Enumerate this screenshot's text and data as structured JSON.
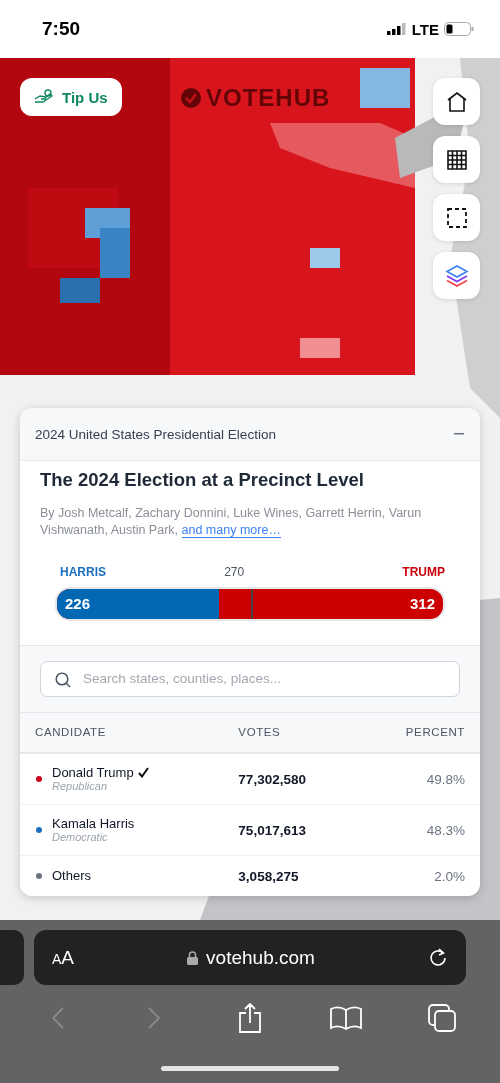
{
  "status_bar": {
    "time": "7:50",
    "network": "LTE"
  },
  "map": {
    "kind": "picture",
    "logo": "VOTEHUB",
    "tip_button": "Tip Us"
  },
  "map_tools": [
    {
      "kind": "home"
    },
    {
      "kind": "grid"
    },
    {
      "kind": "select"
    },
    {
      "kind": "layers"
    }
  ],
  "panel": {
    "header": "2024 United States Presidential Election",
    "title": "The 2024 Election at a Precinct Level",
    "byline": "By Josh Metcalf, Zachary Donnini, Luke Wines, Garrett Herrin, Varun Vishwanath, Austin Park,",
    "byline_link": "and many more…",
    "electoral": {
      "left_label": "HARRIS",
      "threshold": "270",
      "right_label": "TRUMP",
      "left_value": "226",
      "right_value": "312",
      "level": 0.42
    },
    "search": {
      "placeholder": "Search states, counties, places..."
    },
    "table": {
      "columns": [
        "CANDIDATE",
        "VOTES",
        "PERCENT"
      ],
      "rows": [
        {
          "name": "Donald Trump",
          "party": "Republican",
          "winner": true,
          "color": "#d0021b",
          "votes": "77,302,580",
          "percent": "49.8%"
        },
        {
          "name": "Kamala Harris",
          "party": "Democratic",
          "winner": false,
          "color": "#1a6fc0",
          "votes": "75,017,613",
          "percent": "48.3%"
        },
        {
          "name": "Others",
          "winner": false,
          "color": "#6b7280",
          "votes": "3,058,275",
          "percent": "2.0%"
        }
      ]
    }
  },
  "browser": {
    "text_size": "AA",
    "url": "votehub.com"
  }
}
